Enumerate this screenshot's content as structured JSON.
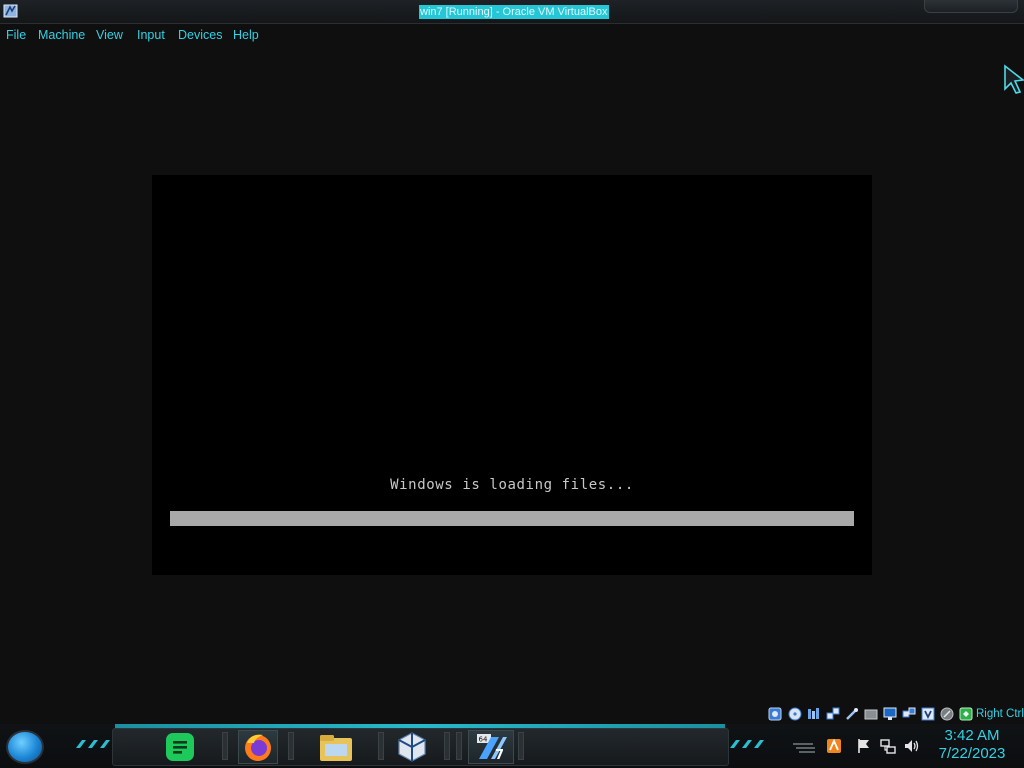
{
  "window": {
    "title": "win7 [Running] - Oracle VM VirtualBox",
    "app_icon": "virtualbox-icon"
  },
  "menubar": {
    "items": [
      "File",
      "Machine",
      "View",
      "Input",
      "Devices",
      "Help"
    ]
  },
  "vm": {
    "loading_text": "Windows is loading files...",
    "progress_fraction": 1.0
  },
  "statusbar": {
    "icons": [
      "hard-disk-icon",
      "optical-drive-icon",
      "audio-icon",
      "network-icon",
      "usb-icon",
      "shared-folders-icon",
      "display-icon",
      "video-capture-icon",
      "virtualization-icon",
      "mouse-integration-icon",
      "host-key-icon"
    ],
    "host_key": "Right Ctrl"
  },
  "taskbar": {
    "start": "start-orb",
    "apps": [
      {
        "name": "notes-app-icon",
        "color": "#1ec95c"
      },
      {
        "name": "firefox-icon",
        "color": "#ff7a1a"
      },
      {
        "name": "file-explorer-icon",
        "color": "#e8c35a"
      },
      {
        "name": "virtualbox-icon",
        "color": "#dfe6ee"
      },
      {
        "name": "win7-vm-icon",
        "color": "#4aa3ff"
      }
    ],
    "tray": [
      "action-center-flag-icon",
      "network-icon",
      "volume-icon"
    ],
    "clock": {
      "time": "3:42 AM",
      "date": "7/22/2023"
    }
  },
  "colors": {
    "accent": "#35d0e3",
    "title_highlight": "#25c7d6",
    "progress": "#a9a9a9"
  }
}
